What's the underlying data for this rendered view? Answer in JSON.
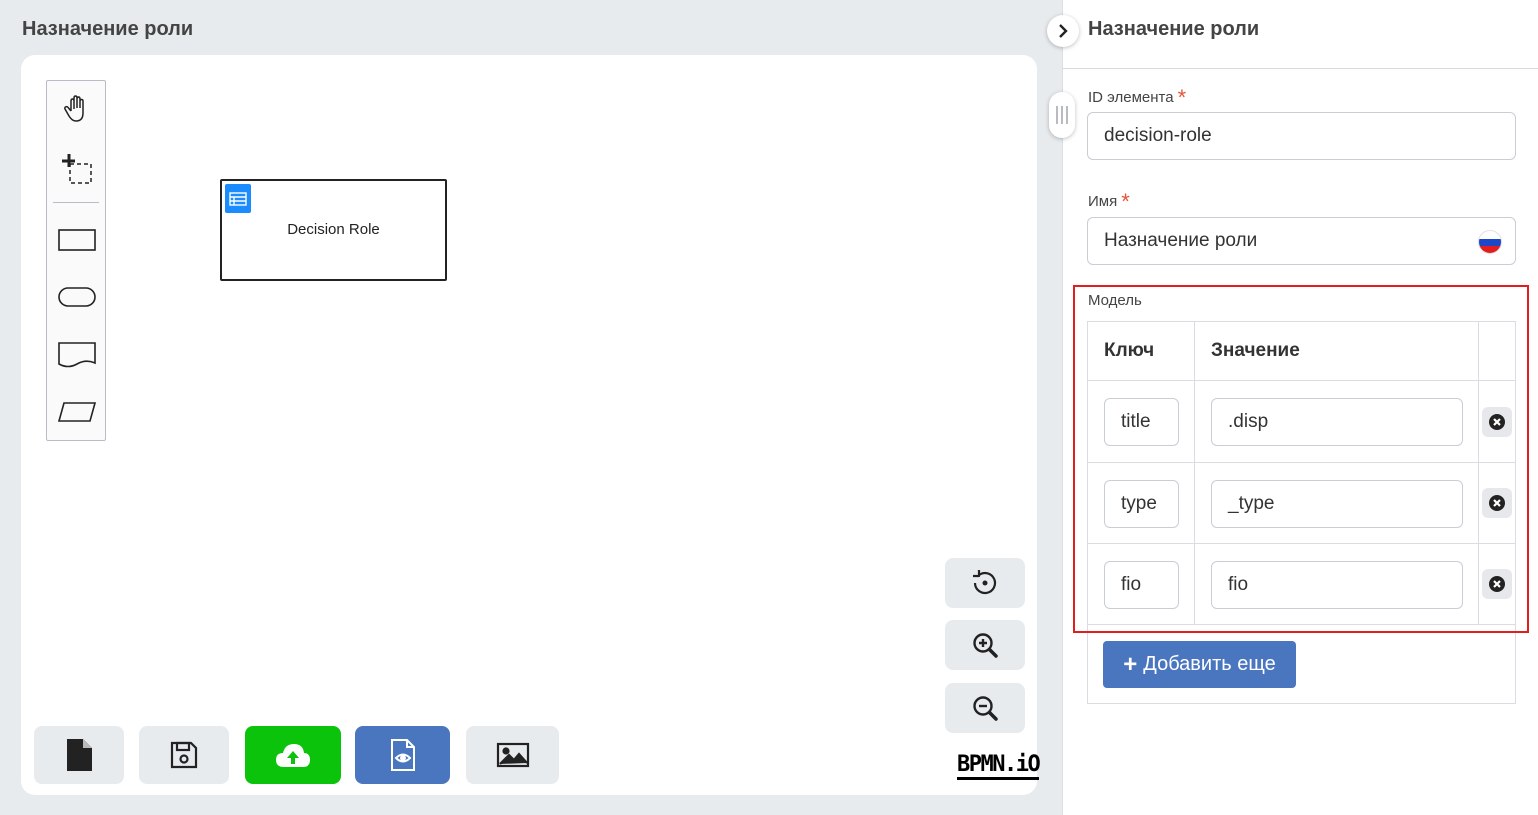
{
  "editor": {
    "title": "Назначение роли",
    "task_label": "Decision Role",
    "task_icon": "table-icon",
    "palette": [
      "hand-tool-icon",
      "lasso-tool-icon",
      "rectangle-shape-icon",
      "rounded-rect-shape-icon",
      "document-shape-icon",
      "parallelogram-shape-icon"
    ],
    "zoom_controls": [
      "reset-view-icon",
      "zoom-in-icon",
      "zoom-out-icon"
    ],
    "toolbar": [
      {
        "icon": "new-file-icon",
        "color": "#e8ebee"
      },
      {
        "icon": "save-icon",
        "color": "#e8ebee"
      },
      {
        "icon": "cloud-upload-icon",
        "color": "#0bc30b"
      },
      {
        "icon": "preview-file-icon",
        "color": "#4a76c0"
      },
      {
        "icon": "image-icon",
        "color": "#e8ebee"
      }
    ],
    "logo": "BPMN.iO"
  },
  "panel": {
    "title": "Назначение роли",
    "id_label": "ID элемента",
    "id_value": "decision-role",
    "name_label": "Имя",
    "name_value": "Назначение роли",
    "required_mark": "*",
    "model_label": "Модель",
    "col_key": "Ключ",
    "col_value": "Значение",
    "rows": [
      {
        "key": "title",
        "value": ".disp"
      },
      {
        "key": "type",
        "value": "_type"
      },
      {
        "key": "fio",
        "value": "fio"
      }
    ],
    "add_label": "Добавить еще",
    "accent_color": "#4a76c0",
    "highlight_color": "#e01e1e"
  }
}
